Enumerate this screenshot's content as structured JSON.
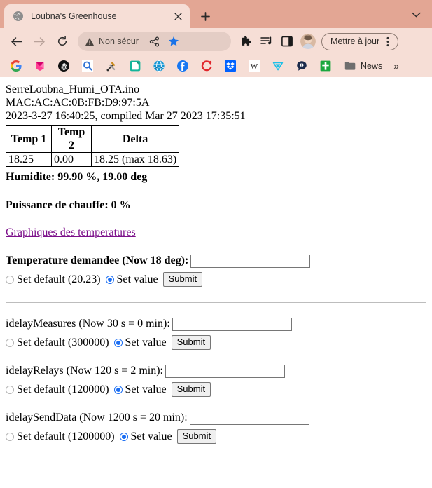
{
  "browser": {
    "tab": {
      "title": "Loubna's Greenhouse",
      "favicon": "globe-icon",
      "close": "×"
    },
    "new_tab": "+",
    "tab_list": "chevron-down-icon",
    "nav": {
      "back": "back-arrow-icon",
      "forward": "forward-arrow-icon",
      "reload": "reload-icon"
    },
    "omnibox": {
      "security_label": "Non sécur",
      "security_icon": "warning-triangle-icon",
      "share_icon": "share-icon",
      "bookmark_icon": "star-filled-icon"
    },
    "toolbar_icons": [
      "extensions-puzzle-icon",
      "media-playlist-icon",
      "side-panel-icon"
    ],
    "avatar": "profile-avatar",
    "update_button": "Mettre à jour",
    "menu": "three-dot-menu-icon",
    "bookmarks": [
      {
        "name": "google-bookmark",
        "color": "#4285f4"
      },
      {
        "name": "pink-book-bookmark",
        "color": "#e9258b"
      },
      {
        "name": "fingerprint-bookmark",
        "color": "#111111"
      },
      {
        "name": "search-magnifier-bookmark",
        "color": "#2b6fd4"
      },
      {
        "name": "tools-hammer-bookmark",
        "color": "#c98a1a"
      },
      {
        "name": "green-note-bookmark",
        "color": "#13b59a"
      },
      {
        "name": "blue-globe-bookmark",
        "color": "#1597d6"
      },
      {
        "name": "facebook-bookmark",
        "color": "#1877f2"
      },
      {
        "name": "red-c-bookmark",
        "color": "#e1262c"
      },
      {
        "name": "dropbox-bookmark",
        "color": "#0061ff"
      },
      {
        "name": "wikipedia-bookmark",
        "color": "#1a1a1a"
      },
      {
        "name": "teal-triangle-bookmark",
        "color": "#1fc0e8"
      },
      {
        "name": "dark-chat-bookmark",
        "color": "#1b2a4a"
      },
      {
        "name": "green-cross-bookmark",
        "color": "#1aa73f"
      }
    ],
    "bookmark_folder": {
      "label": "News",
      "icon": "folder-icon"
    },
    "bookmarks_overflow": "»"
  },
  "page": {
    "sketch_name": "SerreLoubna_Humi_OTA.ino",
    "mac_line": "MAC:AC:AC:0B:FB:D9:97:5A",
    "timestamp_line": "2023-3-27 16:40:25, compiled Mar 27 2023 17:35:51",
    "table": {
      "headers": [
        "Temp 1",
        "Temp 2",
        "Delta"
      ],
      "row": [
        "18.25",
        "0.00",
        "18.25 (max 18.63)"
      ]
    },
    "humidity_line": "Humidite: 99.90 %, 19.00 deg",
    "heating_line": "Puissance de chauffe: 0 %",
    "graph_link": "Graphiques des temperatures",
    "forms": [
      {
        "label": "Temperature demandee (Now 18 deg):",
        "label_bold": true,
        "input_value": "",
        "input_width": 165,
        "default_label": "Set default (20.23)",
        "value_label": "Set value",
        "submit_label": "Submit",
        "selected": "value"
      },
      {
        "label": "idelayMeasures (Now 30 s = 0 min):",
        "label_bold": false,
        "input_value": "",
        "input_width": 165,
        "default_label": "Set default (300000)",
        "value_label": "Set value",
        "submit_label": "Submit",
        "selected": "value"
      },
      {
        "label": "idelayRelays (Now 120 s = 2 min):",
        "label_bold": false,
        "input_value": "",
        "input_width": 165,
        "default_label": "Set default (120000)",
        "value_label": "Set value",
        "submit_label": "Submit",
        "selected": "value"
      },
      {
        "label": "idelaySendData (Now 1200 s = 20 min):",
        "label_bold": false,
        "input_value": "",
        "input_width": 165,
        "default_label": "Set default (1200000)",
        "value_label": "Set value",
        "submit_label": "Submit",
        "selected": "value"
      }
    ]
  }
}
